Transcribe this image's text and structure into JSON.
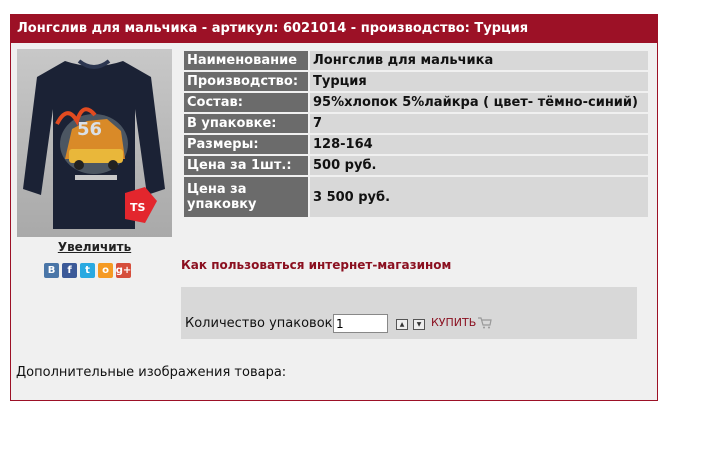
{
  "product": {
    "title": "Лонгслив для мальчика - артикул: 6021014 - производство: Турция",
    "image_alt": "Лонгслив для мальчика",
    "enlarge_label": "Увеличить",
    "brand_mark": "TS"
  },
  "social": [
    {
      "name": "vkontakte",
      "glyph": "B",
      "color": "#4a76a8"
    },
    {
      "name": "facebook",
      "glyph": "f",
      "color": "#3b5998"
    },
    {
      "name": "twitter",
      "glyph": "t",
      "color": "#29a9e1"
    },
    {
      "name": "odnoklassniki",
      "glyph": "o",
      "color": "#f59a23"
    },
    {
      "name": "google-plus",
      "glyph": "g+",
      "color": "#d64e3c"
    }
  ],
  "properties": [
    {
      "key": "Наименование",
      "value": "Лонгслив для мальчика"
    },
    {
      "key": "Производство:",
      "value": "Турция"
    },
    {
      "key": "Состав:",
      "value": "95%хлопок 5%лайкра ( цвет- тёмно-синий)"
    },
    {
      "key": "В упаковке:",
      "value": "7"
    },
    {
      "key": "Размеры:",
      "value": "128-164"
    },
    {
      "key": "Цена за 1шт.:",
      "value": "500 руб."
    },
    {
      "key": "Цена за упаковку",
      "value": "3 500 руб."
    }
  ],
  "help_link": "Как пользоваться интернет-магазином",
  "order": {
    "quantity_label": "Количество упаковок:",
    "quantity_value": "1",
    "buy_label": "КУПИТЬ"
  },
  "extra_images_label": "Дополнительные изображения товара:"
}
